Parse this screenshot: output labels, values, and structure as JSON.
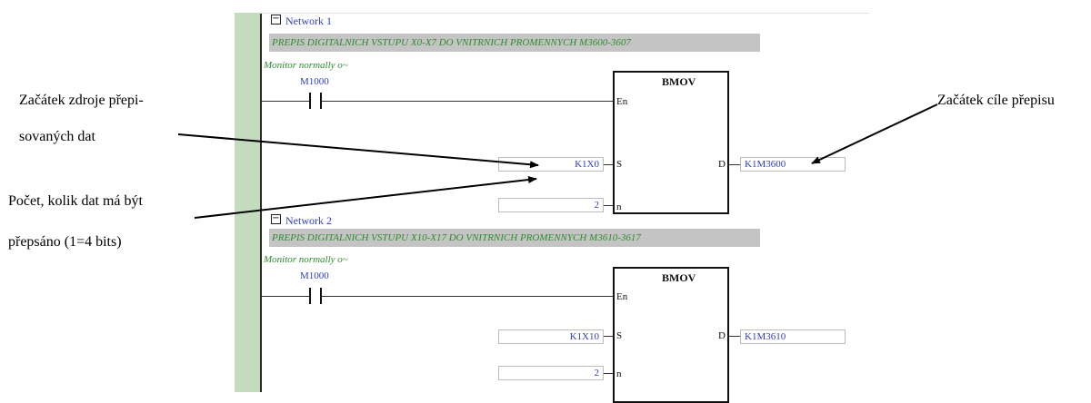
{
  "networks": [
    {
      "label": "Network 1",
      "comment": "PREPIS DIGITALNICH VSTUPU X0-X7 DO VNITRNICH PROMENNYCH M3600-3607",
      "monitor": "Monitor normally o~",
      "contact": "M1000",
      "instruction": "BMOV",
      "pins": {
        "en": "En",
        "s": "S",
        "n": "n",
        "d": "D"
      },
      "source": "K1X0",
      "count": "2",
      "dest": "K1M3600"
    },
    {
      "label": "Network 2",
      "comment": "PREPIS DIGITALNICH VSTUPU X10-X17 DO VNITRNICH PROMENNYCH M3610-3617",
      "monitor": "Monitor normally o~",
      "contact": "M1000",
      "instruction": "BMOV",
      "pins": {
        "en": "En",
        "s": "S",
        "n": "n",
        "d": "D"
      },
      "source": "K1X10",
      "count": "2",
      "dest": "K1M3610"
    }
  ],
  "annotations": {
    "source_start": [
      "Začátek zdroje přepi-",
      "sovaných dat"
    ],
    "count": [
      "Počet, kolik dat má být",
      "přepsáno (1=4 bits)"
    ],
    "dest_start": "Začátek cíle přepisu"
  },
  "icons": {
    "collapse": "minus-box-icon"
  },
  "colors": {
    "gutter": "#c3dcbd",
    "comment_bg": "#c4c4c4",
    "comment_text": "#2e8b2e",
    "operand_text": "#2f3dbf"
  }
}
